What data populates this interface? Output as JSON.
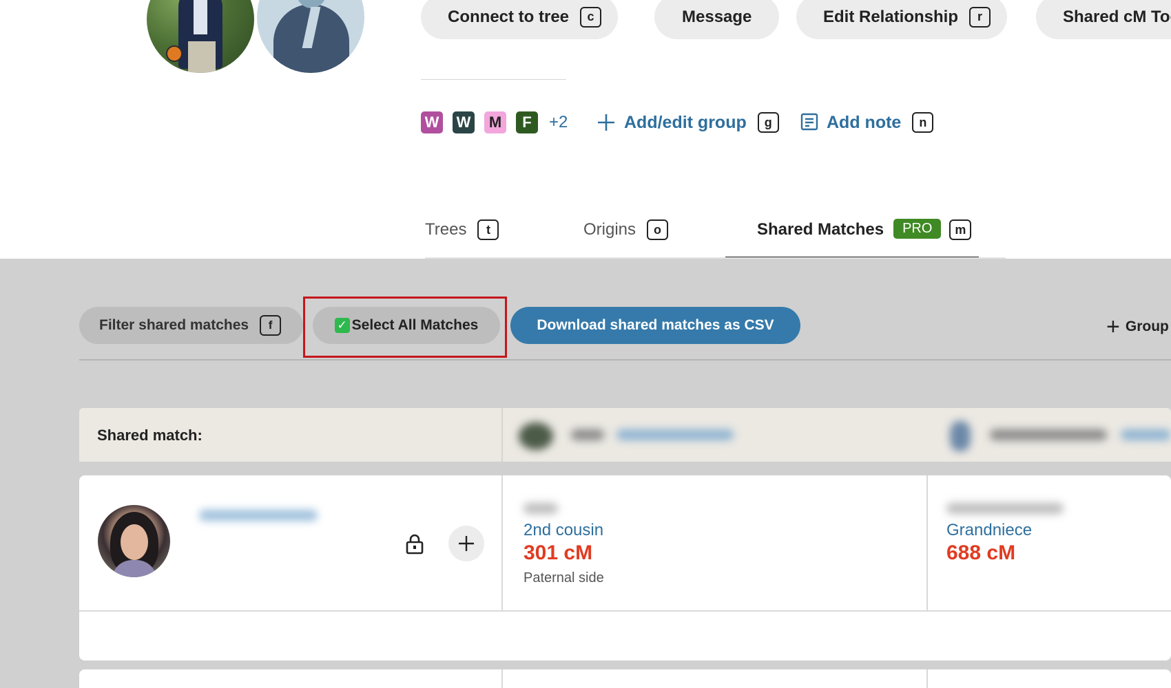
{
  "actions": {
    "connect_to_tree": {
      "label": "Connect to tree",
      "key": "c"
    },
    "message": {
      "label": "Message"
    },
    "edit_relationship": {
      "label": "Edit Relationship",
      "key": "r"
    },
    "shared_cm_tool": {
      "label": "Shared cM Too"
    }
  },
  "groups": {
    "tags": [
      {
        "letter": "W",
        "bg": "#b04f9e",
        "fg": "#ffffff"
      },
      {
        "letter": "W",
        "bg": "#2b4547",
        "fg": "#ffffff"
      },
      {
        "letter": "M",
        "bg": "#f2a6dc",
        "fg": "#222222"
      },
      {
        "letter": "F",
        "bg": "#2e5a22",
        "fg": "#ffffff"
      }
    ],
    "more_count": "+2",
    "add_edit_label": "Add/edit group",
    "add_edit_key": "g",
    "add_note_label": "Add note",
    "add_note_key": "n"
  },
  "tabs": [
    {
      "label": "Trees",
      "key": "t"
    },
    {
      "label": "Origins",
      "key": "o"
    },
    {
      "label": "Shared Matches",
      "key": "m",
      "badge": "PRO",
      "active": true
    }
  ],
  "toolbar": {
    "filter_label": "Filter shared matches",
    "filter_key": "f",
    "select_all_check": "✓",
    "select_all_label": "Select All Matches",
    "download_label": "Download shared matches as CSV",
    "group_label": "Group"
  },
  "table": {
    "header_label": "Shared match:",
    "rows": [
      {
        "col1": {
          "relationship": "2nd cousin",
          "cm": "301 cM",
          "side": "Paternal side"
        },
        "col2": {
          "relationship": "Grandniece",
          "cm": "688 cM"
        }
      }
    ]
  },
  "colors": {
    "accent_blue": "#2e6f9e",
    "csv_button": "#357aaa",
    "cm_red": "#e03c22",
    "pro_green": "#3f8a24",
    "highlight_red": "#c4161c"
  }
}
